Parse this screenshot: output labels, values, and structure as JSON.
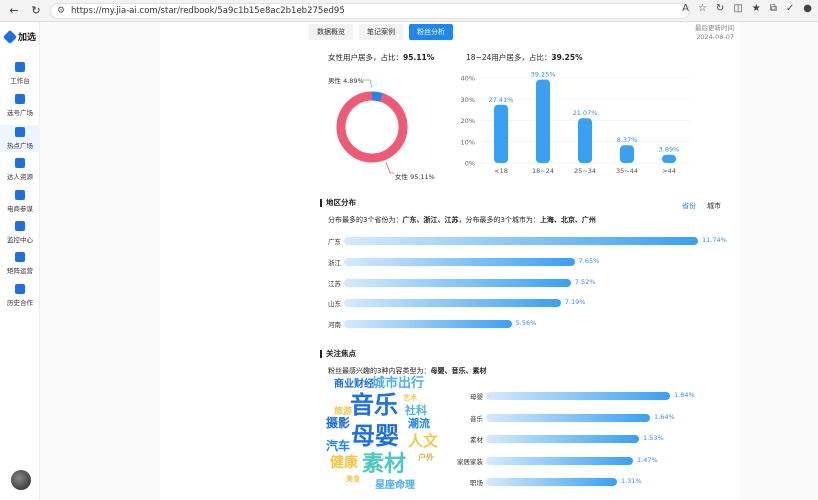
{
  "browser": {
    "url": "https://my.jia-ai.com/star/redbook/5a9c1b15e8ac2b1eb275ed95"
  },
  "sidebar": {
    "brand": "加选",
    "items": [
      {
        "label": "工作台",
        "icon": "desk-icon"
      },
      {
        "label": "选号广场",
        "icon": "search-icon"
      },
      {
        "label": "热点广场",
        "icon": "fire-icon"
      },
      {
        "label": "达人资源",
        "icon": "person-icon"
      },
      {
        "label": "电商参谋",
        "icon": "shop-icon"
      },
      {
        "label": "监控中心",
        "icon": "monitor-icon"
      },
      {
        "label": "矩阵运营",
        "icon": "grid-icon"
      },
      {
        "label": "历史合作",
        "icon": "history-icon"
      }
    ]
  },
  "tabs": [
    {
      "label": "数据概览",
      "active": false
    },
    {
      "label": "笔记案例",
      "active": false
    },
    {
      "label": "粉丝分析",
      "active": true
    }
  ],
  "updated": {
    "label": "最后更新时间",
    "date": "2024-08-07"
  },
  "gender": {
    "summary_prefix": "女性用户居多，占比：",
    "summary_value": "95.11%",
    "male_label": "男性 4.89%",
    "female_label": "女性 95.11%",
    "male_pct": 4.89,
    "female_pct": 95.11,
    "colors": {
      "female": "#ef5a75",
      "male": "#1e88f0"
    }
  },
  "age": {
    "summary_prefix": "18~24用户居多，占比：",
    "summary_value": "39.25%"
  },
  "chart_data": {
    "type": "bar",
    "categories": [
      "<18",
      "18~24",
      "25~34",
      "35~44",
      ">44"
    ],
    "values": [
      27.41,
      39.25,
      21.07,
      8.37,
      3.89
    ],
    "value_labels": [
      "27.41%",
      "39.25%",
      "21.07%",
      "8.37%",
      "3.89%"
    ],
    "y_ticks": [
      "0%",
      "10%",
      "20%",
      "30%",
      "40%"
    ],
    "ylim": [
      0,
      40
    ]
  },
  "region": {
    "title": "地区分布",
    "toggle_province": "省份",
    "toggle_city": "城市",
    "summary_prefix": "分布最多的3个省份为：",
    "summary_provinces": "广东、浙江、江苏",
    "summary_mid": "，分布最多的3个城市为：",
    "summary_cities": "上海、北京、广州",
    "rows": [
      {
        "name": "广东",
        "value": 11.74,
        "label": "11.74%"
      },
      {
        "name": "浙江",
        "value": 7.65,
        "label": "7.65%"
      },
      {
        "name": "江苏",
        "value": 7.52,
        "label": "7.52%"
      },
      {
        "name": "山东",
        "value": 7.19,
        "label": "7.19%"
      },
      {
        "name": "河南",
        "value": 5.56,
        "label": "5.56%"
      }
    ]
  },
  "interest": {
    "title": "关注焦点",
    "summary_prefix": "粉丝最感兴趣的3种内容类型为：",
    "summary_value": "母婴、音乐、素材",
    "rows": [
      {
        "name": "母婴",
        "value": 1.84,
        "label": "1.84%"
      },
      {
        "name": "音乐",
        "value": 1.64,
        "label": "1.64%"
      },
      {
        "name": "素材",
        "value": 1.53,
        "label": "1.53%"
      },
      {
        "name": "家居家装",
        "value": 1.47,
        "label": "1.47%"
      },
      {
        "name": "职场",
        "value": 1.31,
        "label": "1.31%"
      }
    ],
    "words": [
      {
        "text": "商业财经",
        "color": "#1e6fe0"
      },
      {
        "text": "城市出行",
        "color": "#4db0f0"
      },
      {
        "text": "音乐",
        "color": "#1e6fe0"
      },
      {
        "text": "艺术",
        "color": "#f2c84b"
      },
      {
        "text": "摄影",
        "color": "#1e6fe0"
      },
      {
        "text": "潮流",
        "color": "#1e88f0"
      },
      {
        "text": "社科",
        "color": "#4db0f0"
      },
      {
        "text": "旅游",
        "color": "#f2c84b"
      },
      {
        "text": "母婴",
        "color": "#1e6fe0"
      },
      {
        "text": "汽车",
        "color": "#1e88f0"
      },
      {
        "text": "人文",
        "color": "#f2c84b"
      },
      {
        "text": "健康",
        "color": "#f2c84b"
      },
      {
        "text": "素材",
        "color": "#4dc8c0"
      },
      {
        "text": "户外",
        "color": "#f2a94b"
      },
      {
        "text": "美食",
        "color": "#f2c84b"
      },
      {
        "text": "星座命理",
        "color": "#4db0f0"
      }
    ]
  }
}
